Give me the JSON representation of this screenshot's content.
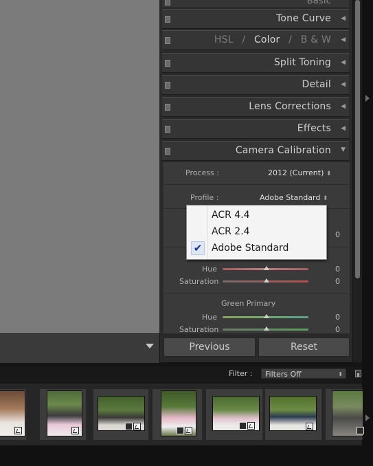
{
  "panels": {
    "basic": "Basic",
    "tone_curve": "Tone Curve",
    "hsl": {
      "hsl": "HSL",
      "sep": "/",
      "color": "Color",
      "bw": "B & W"
    },
    "split_toning": "Split Toning",
    "detail": "Detail",
    "lens_corrections": "Lens Corrections",
    "effects": "Effects",
    "camera_calibration": "Camera Calibration"
  },
  "calibration": {
    "process_label": "Process :",
    "process_value": "2012 (Current)",
    "profile_label": "Profile :",
    "profile_value": "Adobe Standard",
    "up_down_glyph": "⬍",
    "shadows_tint_value": "0",
    "red_primary": {
      "hue_label": "Hue",
      "hue_value": "0",
      "sat_label": "Saturation",
      "sat_value": "0"
    },
    "green_primary": {
      "title": "Green Primary",
      "hue_label": "Hue",
      "hue_value": "0",
      "sat_label": "Saturation",
      "sat_value": "0"
    }
  },
  "profile_menu": {
    "options": [
      "ACR 4.4",
      "ACR 2.4",
      "Adobe Standard"
    ],
    "selected": "Adobe Standard",
    "check_glyph": "✔"
  },
  "buttons": {
    "previous": "Previous",
    "reset": "Reset"
  },
  "filter": {
    "label": "Filter :",
    "value": "Filters Off"
  },
  "colors": {
    "panel_bg": "#353535",
    "body_bg": "#3a3a3a",
    "accent_check": "#1d2c9b",
    "hue_track": "#b06b6b",
    "green_track": "#74a86c"
  },
  "icons": [
    "collapse-square-icon",
    "triangle-left-icon",
    "triangle-down-icon",
    "dropdown-arrow-icon",
    "checkmark-icon",
    "edit-badge-icon",
    "crop-badge-icon"
  ]
}
